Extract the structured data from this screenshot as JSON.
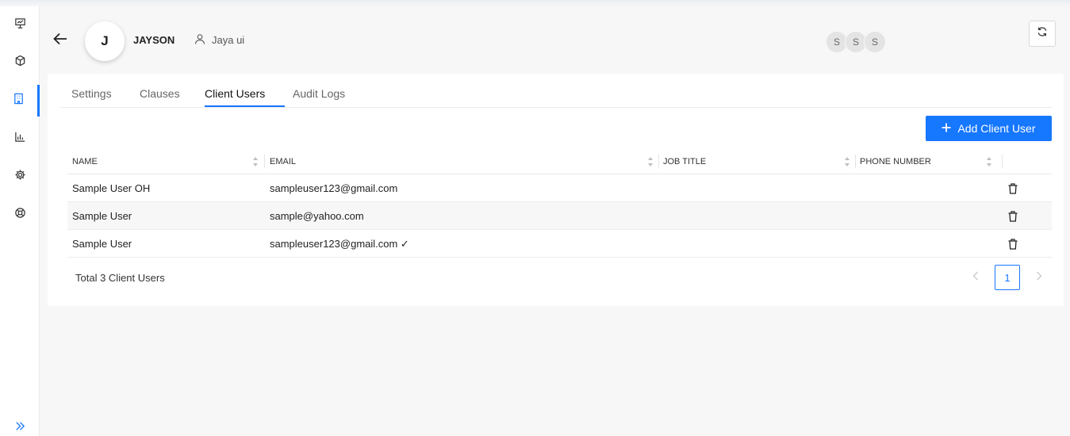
{
  "header": {
    "avatar_initial": "J",
    "company_name": "JAYSON",
    "owner_name": "Jaya ui",
    "user_chips": [
      "S",
      "S",
      "S"
    ]
  },
  "sidebar": {
    "items": [
      {
        "icon": "presentation-icon",
        "active": false
      },
      {
        "icon": "box-icon",
        "active": false
      },
      {
        "icon": "building-icon",
        "active": true
      },
      {
        "icon": "bar-chart-icon",
        "active": false
      },
      {
        "icon": "gear-icon",
        "active": false
      },
      {
        "icon": "lifebuoy-icon",
        "active": false
      }
    ],
    "collapse_icon": "double-chevron-right-icon"
  },
  "tabs": [
    {
      "label": "Settings",
      "active": false
    },
    {
      "label": "Clauses",
      "active": false
    },
    {
      "label": "Client Users",
      "active": true
    },
    {
      "label": "Audit Logs",
      "active": false
    }
  ],
  "add_button_label": "Add Client User",
  "table": {
    "columns": [
      "NAME",
      "EMAIL",
      "JOB TITLE",
      "PHONE NUMBER"
    ],
    "rows": [
      {
        "name": "Sample User OH",
        "email": "sampleuser123@gmail.com",
        "job_title": "",
        "phone": ""
      },
      {
        "name": "Sample User",
        "email": "sample@yahoo.com",
        "job_title": "",
        "phone": ""
      },
      {
        "name": "Sample User",
        "email": "sampleuser123@gmail.com ✓",
        "job_title": "",
        "phone": ""
      }
    ]
  },
  "footer": {
    "total_text": "Total 3 Client Users",
    "current_page": "1"
  },
  "colors": {
    "accent": "#1677ff",
    "background": "#f7f7f7"
  }
}
